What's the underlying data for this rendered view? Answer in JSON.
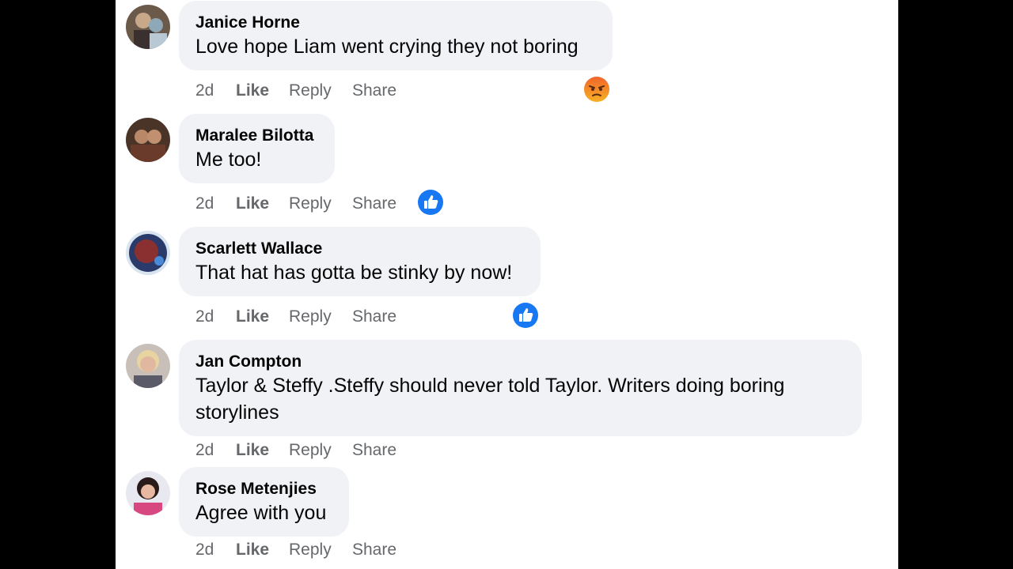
{
  "comments": [
    {
      "author": "Janice Horne",
      "text": "Love hope Liam went crying they not boring",
      "time": "2d",
      "actions": {
        "like": "Like",
        "reply": "Reply",
        "share": "Share"
      },
      "reaction": "angry-reaction-icon"
    },
    {
      "author": "Maralee Bilotta",
      "text": "Me too!",
      "time": "2d",
      "actions": {
        "like": "Like",
        "reply": "Reply",
        "share": "Share"
      },
      "reaction": "like-reaction-icon"
    },
    {
      "author": "Scarlett Wallace",
      "text": "That hat has gotta be stinky by now!",
      "time": "2d",
      "actions": {
        "like": "Like",
        "reply": "Reply",
        "share": "Share"
      },
      "reaction": "like-reaction-icon"
    },
    {
      "author": "Jan Compton",
      "text": "Taylor & Steffy .Steffy should never told Taylor. Writers doing boring storylines",
      "time": "2d",
      "actions": {
        "like": "Like",
        "reply": "Reply",
        "share": "Share"
      },
      "reaction": ""
    },
    {
      "author": "Rose Metenjies",
      "text": "Agree with you",
      "time": "2d",
      "actions": {
        "like": "Like",
        "reply": "Reply",
        "share": "Share"
      },
      "reaction": ""
    }
  ],
  "colors": {
    "bubble": "#f0f2f5",
    "action_text": "#65676b",
    "like_blue": "#1877f2",
    "angry_orange": "#f0652b"
  }
}
